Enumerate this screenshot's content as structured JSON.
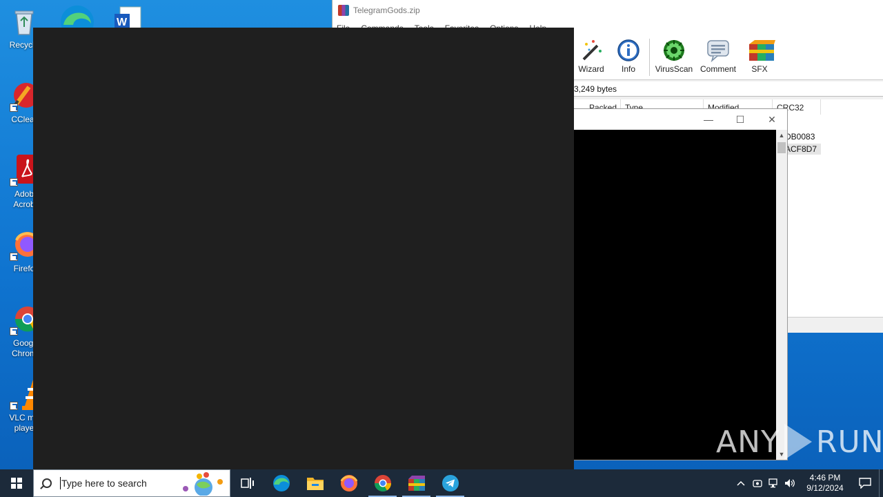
{
  "desktop": {
    "icons": [
      {
        "label": "Recycle"
      },
      {
        "label": "CClear"
      },
      {
        "label": "Adob\nAcrob"
      },
      {
        "label": "Firefo"
      },
      {
        "label": "Googl\nChrom"
      },
      {
        "label": "VLC me\nplaye"
      }
    ]
  },
  "winrar": {
    "title": "TelegramGods.zip",
    "menu": [
      "File",
      "Commands",
      "Tools",
      "Favorites",
      "Options",
      "Help"
    ],
    "toolbar": [
      {
        "label": "Wizard",
        "icon": "wizard-icon"
      },
      {
        "label": "Info",
        "icon": "info-icon"
      },
      {
        "label": "VirusScan",
        "icon": "virusscan-icon"
      },
      {
        "label": "Comment",
        "icon": "comment-icon"
      },
      {
        "label": "SFX",
        "icon": "sfx-icon"
      }
    ],
    "path_text": "3,249 bytes",
    "columns": [
      "Packed",
      "Type",
      "Modified",
      "CRC32"
    ],
    "rows": [
      {
        "crc": "DB0083"
      },
      {
        "crc": "ACF8D7"
      }
    ]
  },
  "console": {
    "minimize": "—",
    "maximize": "☐",
    "close": "✕"
  },
  "watermark": {
    "left": "ANY",
    "right": "RUN"
  },
  "taskbar": {
    "search_placeholder": "Type here to search",
    "time": "4:46 PM",
    "date": "9/12/2024",
    "apps": [
      "task-view-icon",
      "edge-icon",
      "file-explorer-icon",
      "firefox-icon",
      "chrome-icon",
      "winrar-icon",
      "telegram-icon"
    ]
  },
  "colors": {
    "desktop_accent": "#0f74d0",
    "dark_window": "#1f1f1f",
    "taskbar": "#1c2a3a"
  }
}
